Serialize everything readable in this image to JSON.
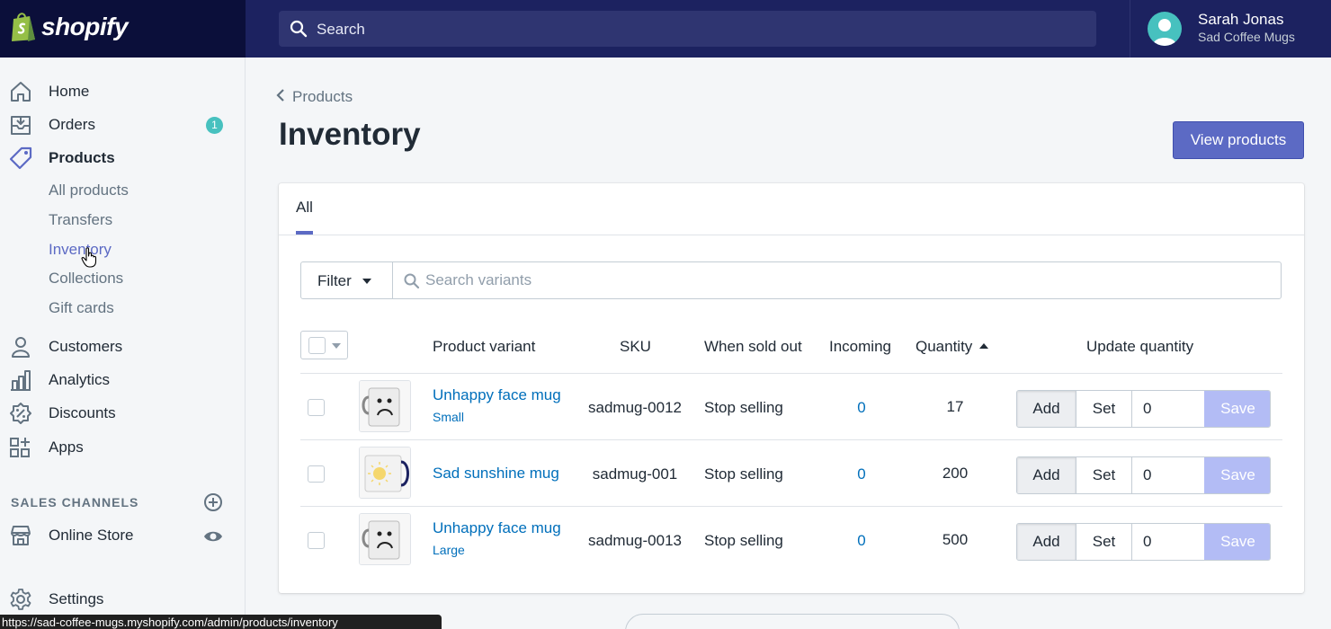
{
  "app": {
    "logo_text": "shopify",
    "search_placeholder": "Search"
  },
  "user": {
    "name": "Sarah Jonas",
    "store": "Sad Coffee Mugs"
  },
  "sidebar": {
    "items": [
      {
        "label": "Home",
        "icon": "home-icon"
      },
      {
        "label": "Orders",
        "icon": "orders-icon",
        "badge": "1"
      },
      {
        "label": "Products",
        "icon": "tag-icon"
      },
      {
        "label": "Customers",
        "icon": "person-icon"
      },
      {
        "label": "Analytics",
        "icon": "bar-chart-icon"
      },
      {
        "label": "Discounts",
        "icon": "discount-icon"
      },
      {
        "label": "Apps",
        "icon": "apps-icon"
      }
    ],
    "product_subitems": [
      "All products",
      "Transfers",
      "Inventory",
      "Collections",
      "Gift cards"
    ],
    "active_subitem": "Inventory",
    "sales_channels_title": "SALES CHANNELS",
    "online_store": "Online Store",
    "settings": "Settings"
  },
  "page": {
    "breadcrumb": "Products",
    "title": "Inventory",
    "view_products_button": "View products"
  },
  "tabs": [
    "All"
  ],
  "filter": {
    "label": "Filter",
    "search_placeholder": "Search variants"
  },
  "table": {
    "headers": [
      "Product variant",
      "SKU",
      "When sold out",
      "Incoming",
      "Quantity",
      "Update quantity"
    ],
    "sorted_column": "Quantity",
    "sort_direction": "ascending",
    "rows": [
      {
        "name": "Unhappy face mug",
        "variant": "Small",
        "sku": "sadmug-0012",
        "when_sold_out": "Stop selling",
        "incoming": "0",
        "quantity": "17",
        "input": "0",
        "thumb": "sad-face-mug"
      },
      {
        "name": "Sad sunshine mug",
        "variant": "",
        "sku": "sadmug-001",
        "when_sold_out": "Stop selling",
        "incoming": "0",
        "quantity": "200",
        "input": "0",
        "thumb": "sunshine-mug"
      },
      {
        "name": "Unhappy face mug",
        "variant": "Large",
        "sku": "sadmug-0013",
        "when_sold_out": "Stop selling",
        "incoming": "0",
        "quantity": "500",
        "input": "0",
        "thumb": "sad-face-mug"
      }
    ],
    "add_label": "Add",
    "set_label": "Set",
    "save_label": "Save"
  },
  "status_bar_url": "https://sad-coffee-mugs.myshopify.com/admin/products/inventory",
  "colors": {
    "topbar": "#1c2260",
    "accent": "#5c6ac4",
    "link": "#006fbb",
    "badge": "#47c1bf",
    "save_disabled": "#b3bcf5"
  }
}
